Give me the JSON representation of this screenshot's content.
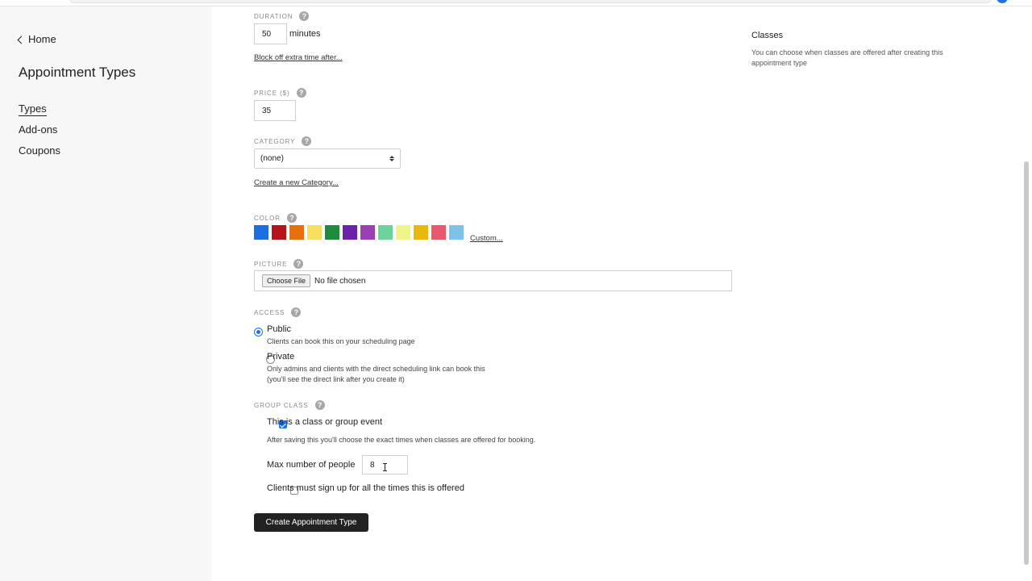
{
  "sidebar": {
    "home_label": "Home",
    "title": "Appointment Types",
    "items": [
      {
        "label": "Types",
        "active": true
      },
      {
        "label": "Add-ons",
        "active": false
      },
      {
        "label": "Coupons",
        "active": false
      }
    ]
  },
  "form": {
    "duration": {
      "label": "DURATION",
      "value": "50",
      "unit": "minutes",
      "block_link": "Block off extra time after..."
    },
    "price": {
      "label": "PRICE ($)",
      "value": "35"
    },
    "category": {
      "label": "CATEGORY",
      "selected": "(none)",
      "create_link": "Create a new Category..."
    },
    "color": {
      "label": "COLOR",
      "swatches": [
        "#1b6fe0",
        "#b5121b",
        "#e8700a",
        "#f7df5f",
        "#1e8c3c",
        "#6b21a8",
        "#9b3fb5",
        "#6ed39a",
        "#f0f38a",
        "#e8b80e",
        "#e8586e",
        "#7ec2ea"
      ],
      "custom_link": "Custom..."
    },
    "picture": {
      "label": "PICTURE",
      "button": "Choose File",
      "status": "No file chosen"
    },
    "access": {
      "label": "ACCESS",
      "options": [
        {
          "label": "Public",
          "desc1": "Clients can book this on your scheduling page",
          "desc2": "",
          "selected": true
        },
        {
          "label": "Private",
          "desc1": "Only admins and clients with the direct scheduling link can book this",
          "desc2": "(you'll see the direct link after you create it)",
          "selected": false
        }
      ]
    },
    "group_class": {
      "label": "GROUP CLASS",
      "checkbox_label": "This is a class or group event",
      "checked": true,
      "note": "After saving this you'll choose the exact times when classes are offered for booking.",
      "max_label": "Max number of people",
      "max_value": "8",
      "signup_label": "Clients must sign up for all the times this is offered",
      "signup_checked": false
    },
    "submit_label": "Create Appointment Type"
  },
  "right_panel": {
    "title": "Classes",
    "text": "You can choose when classes are offered after creating this appointment type"
  },
  "icons": {
    "help": "?"
  }
}
